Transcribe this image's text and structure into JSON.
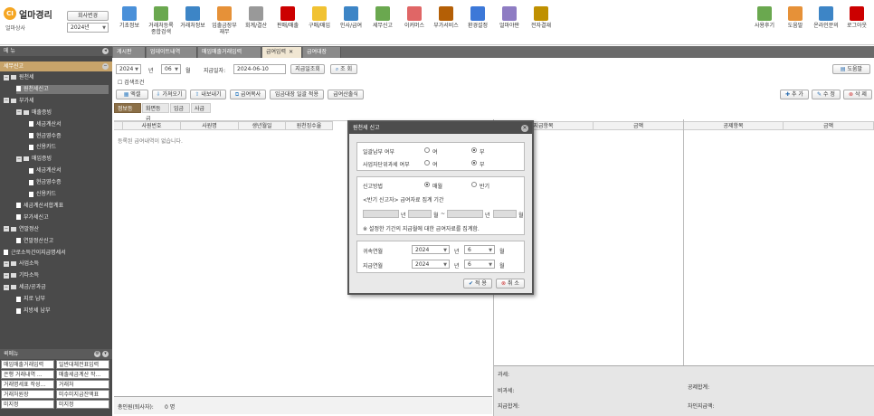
{
  "app": {
    "name": "얼마경리",
    "company": "얼마상사",
    "logo_mark": "CI"
  },
  "topbar": {
    "company_change": "회사변경",
    "year": "2024년",
    "menus": [
      "기초정보",
      "거래처등록 종합검색",
      "거래처정보",
      "입출금장부 재무",
      "회계/결산",
      "판매/매출",
      "구매/매입",
      "인사/급여",
      "세무신고",
      "이커머스",
      "부가서비스",
      "환경설정",
      "얼마야판",
      "전자결재"
    ],
    "right_menus": [
      "사용후기",
      "도움말",
      "온라인문의",
      "로그아웃"
    ]
  },
  "left": {
    "menu_header": "메 뉴",
    "section_header": "세무신고",
    "tree": [
      {
        "label": "원천세",
        "level": 0,
        "type": "folder"
      },
      {
        "label": "원천세신고",
        "level": 1,
        "type": "page",
        "selected": true
      },
      {
        "label": "부가세",
        "level": 0,
        "type": "folder"
      },
      {
        "label": "매출증빙",
        "level": 1,
        "type": "folder"
      },
      {
        "label": "세금계산서",
        "level": 2,
        "type": "page"
      },
      {
        "label": "현금영수증",
        "level": 2,
        "type": "page"
      },
      {
        "label": "신용카드",
        "level": 2,
        "type": "page"
      },
      {
        "label": "매입증빙",
        "level": 1,
        "type": "folder"
      },
      {
        "label": "세금계산서",
        "level": 2,
        "type": "page"
      },
      {
        "label": "현금영수증",
        "level": 2,
        "type": "page"
      },
      {
        "label": "신용카드",
        "level": 2,
        "type": "page"
      },
      {
        "label": "세금계산서합계표",
        "level": 1,
        "type": "page"
      },
      {
        "label": "부가세신고",
        "level": 1,
        "type": "page"
      },
      {
        "label": "연말정산",
        "level": 0,
        "type": "folder"
      },
      {
        "label": "연말정산신고",
        "level": 1,
        "type": "page"
      },
      {
        "label": "근로소득간이지급명세서",
        "level": 0,
        "type": "page"
      },
      {
        "label": "사업소득",
        "level": 0,
        "type": "folder"
      },
      {
        "label": "기타소득",
        "level": 0,
        "type": "folder"
      },
      {
        "label": "세금/공과금",
        "level": 0,
        "type": "folder"
      },
      {
        "label": "지로 납부",
        "level": 1,
        "type": "page"
      },
      {
        "label": "지방세 납부",
        "level": 1,
        "type": "page"
      }
    ],
    "quick_header": "퀵메뉴",
    "quick": [
      "매입매출거래입력",
      "일반대체전표입력",
      "은행 거래내역 ...",
      "매출세금계산 작...",
      "거래명세표 작성...",
      "거래처",
      "거래처원장",
      "미수미지급잔액표",
      "미지정",
      "미지정"
    ]
  },
  "tabs": [
    "게시판",
    "업데이트내역",
    "매입매출거래입력",
    "급여입력",
    "급여대장"
  ],
  "main": {
    "year": "2024",
    "year_unit": "년",
    "month": "06",
    "month_unit": "월",
    "pay_date_label": "지급일자:",
    "pay_date": "2024-06-10",
    "pay_query": "지급일조회",
    "search": "조 회",
    "help": "도움말",
    "search_cond": "검색조건",
    "toolbar": [
      "엑셀",
      "가져오기",
      "내보내기",
      "급여복사",
      "임금대장 일괄 적용",
      "급여산출식"
    ],
    "actions": [
      "추 가",
      "수 정",
      "삭 제"
    ],
    "subtabs": [
      "정보등급",
      "화면등급",
      "임금",
      "사급"
    ],
    "grid_headers": [
      "사원번호",
      "사원명",
      "생년월일",
      "원천징수율",
      "지급항목",
      "금액",
      "공제항목",
      "금액"
    ],
    "empty": "등록된 급여내역이 없습니다.",
    "footer_count": "총인원(퇴사자):",
    "footer_value": "0 명",
    "sum_labels": [
      "과세:",
      "비과세:",
      "지급합계:",
      "공제합계:",
      "차인지급액:"
    ]
  },
  "dialog": {
    "title": "원천세 신고",
    "monthly_label": "일괄납부 여부",
    "monthly_opts": [
      "여",
      "부"
    ],
    "biz_label": "사업자단위과세 여부",
    "biz_opts": [
      "여",
      "부"
    ],
    "method_label": "신고방법",
    "method_opts": [
      "매월",
      "반기"
    ],
    "half_note": "<반기 신고자> 급여자료 집계 기간",
    "year_unit": "년",
    "month_unit": "월",
    "dash": "~",
    "note": "※ 설정한 기간의 지급월에 대한 급여자료를 집계함.",
    "belong_label": "귀속연월",
    "belong_year": "2024",
    "belong_month": "6",
    "pay_label": "지급연월",
    "pay_year": "2024",
    "pay_month": "6",
    "ok": "적 용",
    "cancel": "취 소"
  }
}
